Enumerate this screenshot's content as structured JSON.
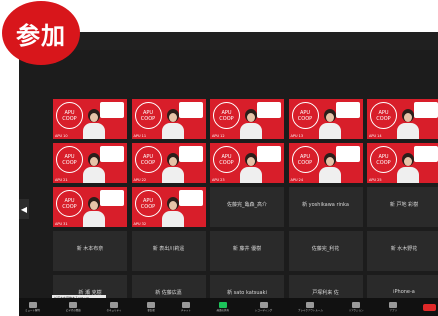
{
  "badge": "参加",
  "tiles_row1": [
    {
      "name": "APU 10"
    },
    {
      "name": "APU 11"
    },
    {
      "name": "APU 12"
    },
    {
      "name": "APU 13"
    },
    {
      "name": "APU 14"
    }
  ],
  "tiles_row2": [
    {
      "name": "APU 21"
    },
    {
      "name": "APU 22"
    },
    {
      "name": "APU 23"
    },
    {
      "name": "APU 24"
    },
    {
      "name": "APU 25"
    }
  ],
  "tiles_row3_video": [
    {
      "name": "APU 31"
    },
    {
      "name": "APU 32"
    }
  ],
  "tiles_row3_names": [
    "佐藤完_亀森_高介",
    "新 yoshikawa rinka",
    "新 戸地 彩樹"
  ],
  "tiles_row4_names": [
    "新 木本布奈",
    "新 表出川莉遥",
    "新 藤井 優樹",
    "佐藤完_利花",
    "新 水木野花"
  ],
  "tiles_row5_names": [
    "新 瀬 克樹",
    "新 佐藤広嘉",
    "新 sato katsuaki",
    "戸塚利来 佐",
    "iPhone-a"
  ],
  "toolbar": [
    {
      "label": "ミュート解除",
      "icon": "microphone-icon"
    },
    {
      "label": "ビデオの開始",
      "icon": "camera-icon"
    },
    {
      "label": "セキュリティ",
      "icon": "shield-icon"
    },
    {
      "label": "参加者",
      "icon": "participants-icon"
    },
    {
      "label": "チャット",
      "icon": "chat-icon"
    },
    {
      "label": "画面の共有",
      "icon": "share-screen-icon"
    },
    {
      "label": "レコーディング",
      "icon": "record-icon"
    },
    {
      "label": "ブレイクアウトルーム",
      "icon": "breakout-icon"
    },
    {
      "label": "リアクション",
      "icon": "reaction-icon"
    },
    {
      "label": "アプリ",
      "icon": "apps-icon"
    }
  ],
  "tooltip": "ビデオを開始する(Alt+V)"
}
